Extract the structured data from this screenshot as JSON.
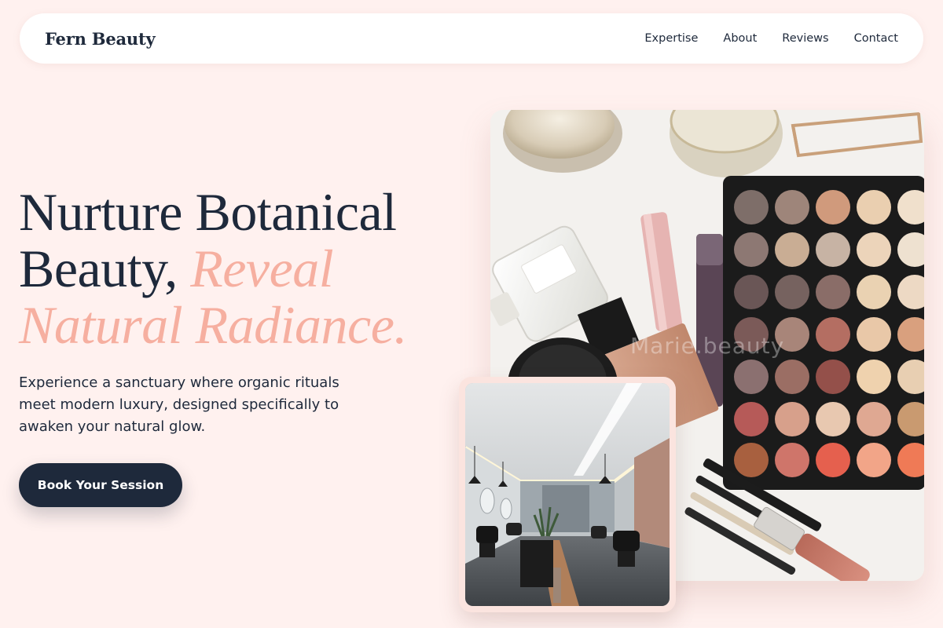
{
  "nav": {
    "brand": "Fern Beauty",
    "items": [
      {
        "label": "Expertise"
      },
      {
        "label": "About"
      },
      {
        "label": "Reviews"
      },
      {
        "label": "Contact"
      }
    ]
  },
  "hero": {
    "headline_part1": "Nurture Botanical Beauty, ",
    "headline_accent": "Reveal Natural Radiance.",
    "lead": "Experience a sanctuary where organic rituals meet modern luxury, designed specifically to awaken your natural glow.",
    "cta_label": "Book Your Session"
  },
  "images": {
    "main_watermark": "Marie.beauty"
  },
  "colors": {
    "background": "#fff1ef",
    "navy": "#1e293b",
    "accent_peach": "#f6afa0",
    "white": "#ffffff"
  }
}
